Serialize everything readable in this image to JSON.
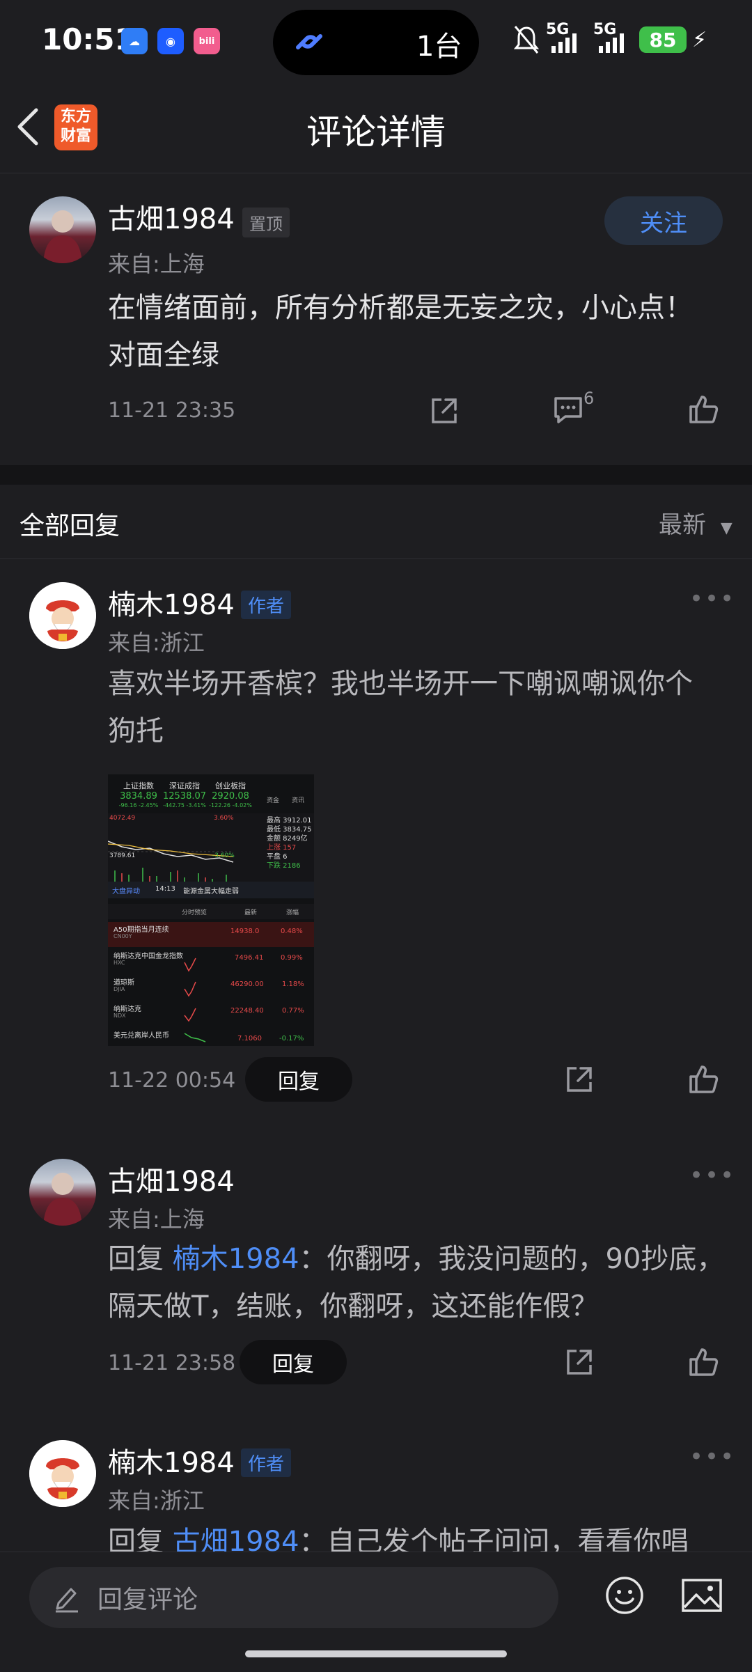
{
  "status": {
    "time": "10:51",
    "island_text": "1台",
    "net1": "5G",
    "net2": "5G",
    "battery": "85"
  },
  "nav": {
    "title": "评论详情",
    "logo_line1": "东方",
    "logo_line2": "财富"
  },
  "main_post": {
    "username": "古畑1984",
    "pin_tag": "置顶",
    "location": "来自:上海",
    "content_line1": "在情绪面前，所有分析都是无妄之灾，小心点！",
    "content_line2": "对面全绿",
    "date": "11-21 23:35",
    "reply_count": "6",
    "follow_label": "关注"
  },
  "replies_header": {
    "title": "全部回复",
    "sort_label": "最新"
  },
  "replies": [
    {
      "username": "楠木1984",
      "tag": "作者",
      "location": "来自:浙江",
      "content_line1": "喜欢半场开香槟？我也半场开一下嘲讽嘲讽你个",
      "content_line2": "狗托",
      "date": "11-22 00:54",
      "reply_label": "回复"
    },
    {
      "username": "古畑1984",
      "location": "来自:上海",
      "reply_prefix": "回复",
      "mention": "楠木1984",
      "content_line1": "：你翻呀，我没问题的，90抄底，",
      "content_line2": "隔天做T，结账，你翻呀，这还能作假？",
      "date": "11-21 23:58",
      "reply_label": "回复"
    },
    {
      "username": "楠木1984",
      "tag": "作者",
      "location": "来自:浙江",
      "reply_prefix": "回复",
      "mention": "古畑1984",
      "content_line1": "：自己发个帖子问问，看看你唱"
    }
  ],
  "thumbnail": {
    "indexes": [
      {
        "name": "上证指数",
        "value": "3834.89",
        "change": "-96.16 -2.45%"
      },
      {
        "name": "深证成指",
        "value": "12538.07",
        "change": "-442.75 -3.41%"
      },
      {
        "name": "创业板指",
        "value": "2920.08",
        "change": "-122.26 -4.02%"
      }
    ],
    "side_labels": [
      "资金",
      "资讯"
    ],
    "chart_values": [
      "4072.49",
      "3.60%",
      "3789.61",
      "-3.60%"
    ],
    "stats": [
      "最高 3912.01",
      "最低 3834.75",
      "金额 8249亿",
      "上涨 157",
      "平盘 6",
      "下跌 2186"
    ],
    "ticker_label": "大盘异动",
    "ticker_time": "14:13",
    "ticker_text": "能源金属大幅走弱",
    "table_headers": [
      "分时预览",
      "最新",
      "涨幅"
    ],
    "rows": [
      {
        "name": "A50期指当月连续",
        "code": "CN00Y",
        "price": "14938.0",
        "change": "0.48%"
      },
      {
        "name": "纳斯达克中国金龙指数",
        "code": "HXC",
        "price": "7496.41",
        "change": "0.99%"
      },
      {
        "name": "道琼斯",
        "code": "DJIA",
        "price": "46290.00",
        "change": "1.18%"
      },
      {
        "name": "纳斯达克",
        "code": "NDX",
        "price": "22248.40",
        "change": "0.77%"
      },
      {
        "name": "美元兑离岸人民币",
        "code": "",
        "price": "7.1060",
        "change": "-0.17%"
      }
    ]
  },
  "bottom": {
    "input_placeholder": "回复评论"
  }
}
